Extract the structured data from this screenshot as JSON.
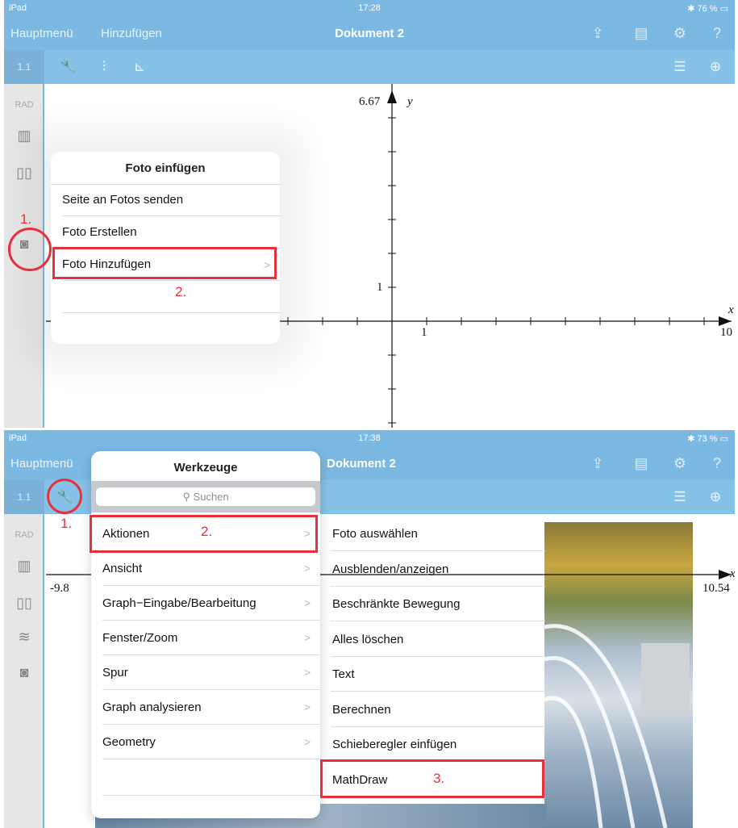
{
  "screen1": {
    "status": {
      "device": "iPad",
      "time": "17:28",
      "battery": "76 %"
    },
    "nav": {
      "main_menu": "Hauptmenü",
      "add": "Hinzufügen",
      "doc_title": "Dokument 2"
    },
    "page_label": "1.1",
    "angle_mode": "RAD",
    "popover": {
      "title": "Foto einfügen",
      "items": [
        "Seite an Fotos senden",
        "Foto Erstellen",
        "Foto Hinzufügen"
      ]
    },
    "axes": {
      "y_max_label": "6.67",
      "y_name": "y",
      "y_tick": "1",
      "x_name": "x",
      "x_tick": "1",
      "x_max_label": "10"
    },
    "annotations": {
      "step1": "1.",
      "step2": "2."
    }
  },
  "screen2": {
    "status": {
      "device": "iPad",
      "time": "17:38",
      "battery": "73 %"
    },
    "nav": {
      "main_menu": "Hauptmenü",
      "doc_title": "Dokument 2"
    },
    "page_label": "1.1",
    "angle_mode": "RAD",
    "tools_menu": {
      "title": "Werkzeuge",
      "search_placeholder": "Suchen",
      "items": [
        "Aktionen",
        "Ansicht",
        "Graph−Eingabe/Bearbeitung",
        "Fenster/Zoom",
        "Spur",
        "Graph analysieren",
        "Geometry"
      ]
    },
    "submenu": {
      "items": [
        "Foto auswählen",
        "Ausblenden/anzeigen",
        "Beschränkte Bewegung",
        "Alles löschen",
        "Text",
        "Berechnen",
        "Schieberegler einfügen",
        "MathDraw"
      ]
    },
    "axes": {
      "x_min_label": "-9.8",
      "x_max_label": "10.54",
      "x_name": "x"
    },
    "annotations": {
      "step1": "1.",
      "step2": "2.",
      "step3": "3."
    }
  },
  "colors": {
    "bar_blue": "#7bb8e2",
    "toolbar_blue": "#86c1e8",
    "highlight_red": "#e8303a"
  }
}
